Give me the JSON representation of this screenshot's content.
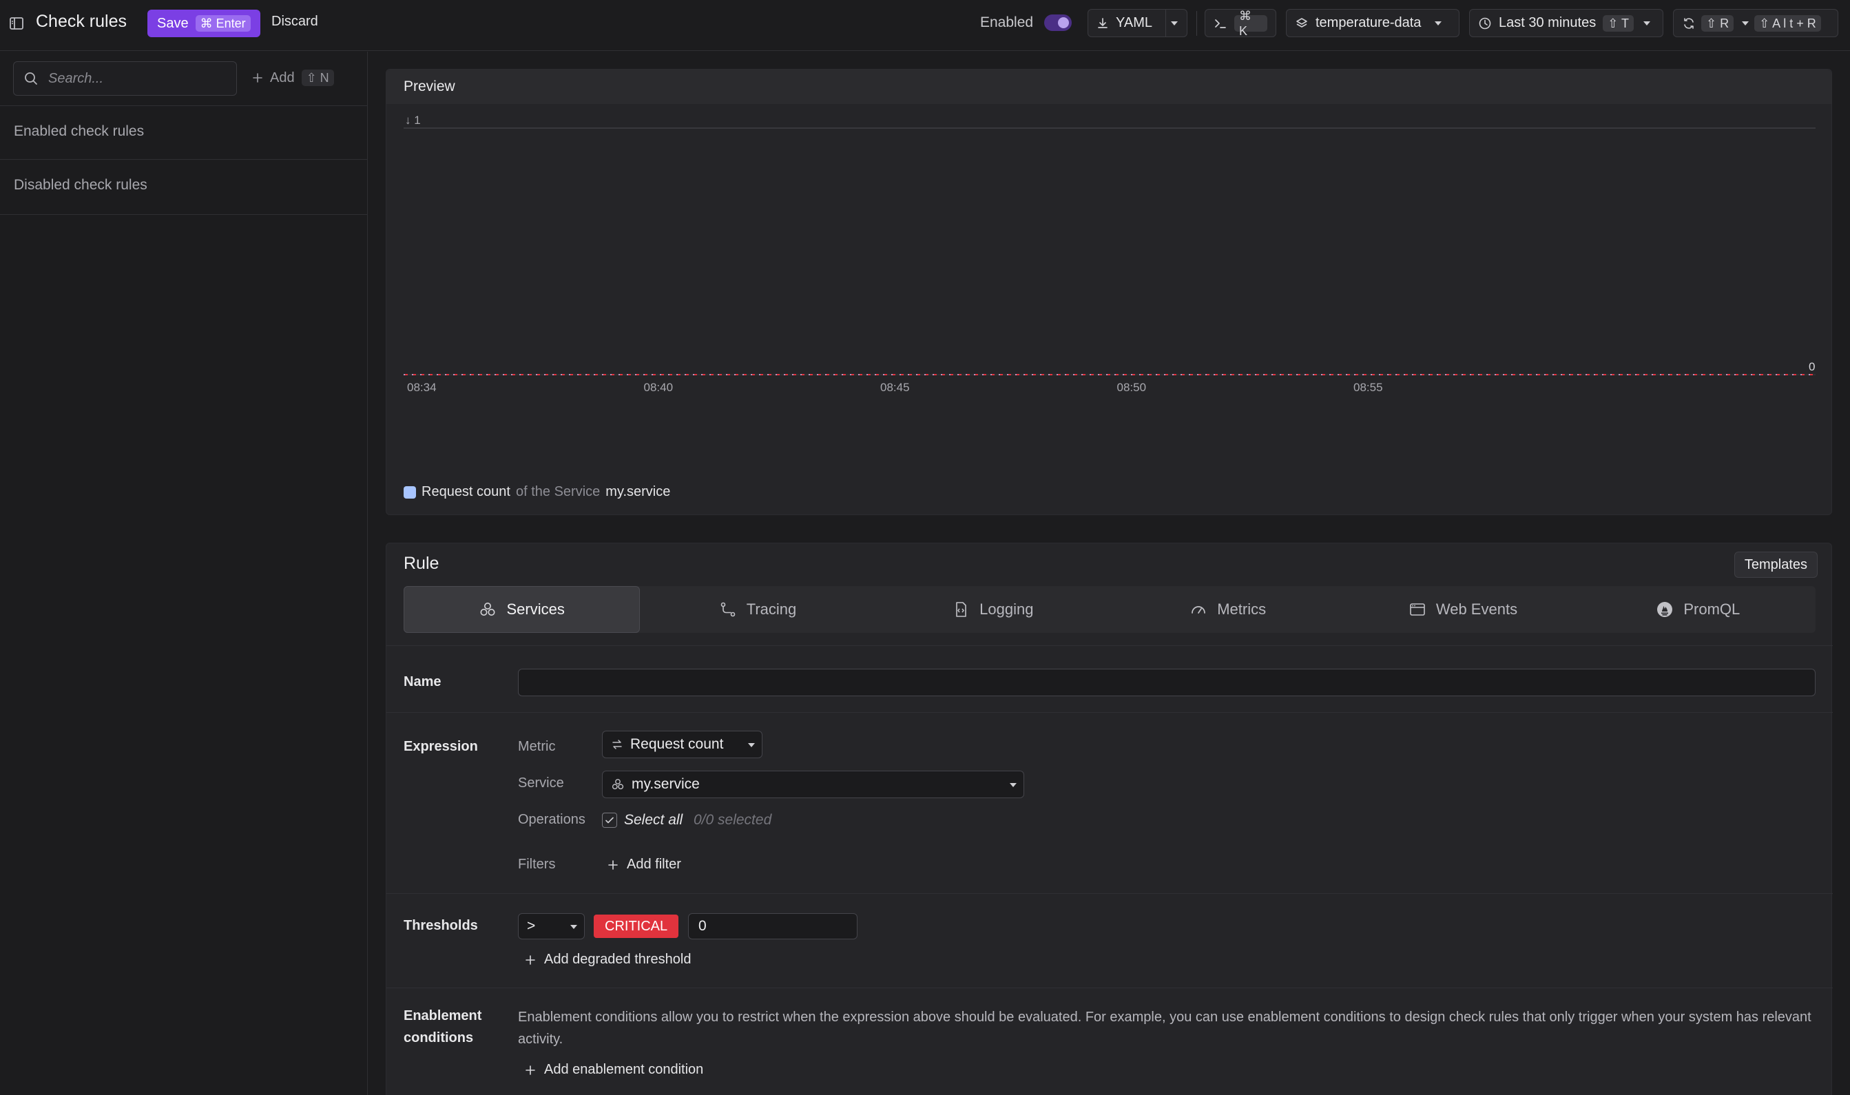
{
  "header": {
    "title": "Check rules",
    "save_label": "Save",
    "save_shortcut": "⌘ Enter",
    "discard_label": "Discard",
    "enabled_label": "Enabled",
    "enabled": true,
    "yaml_label": "YAML",
    "command_shortcut": "⌘ K",
    "dataset": "temperature-data",
    "time_range": "Last 30 minutes",
    "time_shortcut": "⇧ T",
    "refresh_shortcut": "⇧ R",
    "auto_refresh_shortcut": "⇧ A l t + R",
    "accent_color": "#7b3fe4"
  },
  "sidebar": {
    "search_placeholder": "Search...",
    "add_label": "Add",
    "add_shortcut": "⇧ N",
    "groups": [
      "Enabled check rules",
      "Disabled check rules"
    ]
  },
  "preview": {
    "title": "Preview",
    "legend": {
      "metric": "Request count",
      "connector": "of the Service",
      "service": "my.service",
      "color": "#a8c5ff"
    }
  },
  "chart_data": {
    "type": "line",
    "x": [
      "08:34",
      "08:40",
      "08:45",
      "08:50",
      "08:55"
    ],
    "series": [
      {
        "name": "Request count of the Service my.service",
        "values": [
          0,
          0,
          0,
          0,
          0
        ]
      }
    ],
    "threshold": {
      "value": 0,
      "color": "#e1333d"
    },
    "y_top_label": "1",
    "y_right_label": "0",
    "ylim": [
      0,
      1
    ],
    "grid": true
  },
  "rule": {
    "title": "Rule",
    "templates_label": "Templates",
    "tabs": [
      {
        "label": "Services",
        "icon": "services-icon",
        "active": true
      },
      {
        "label": "Tracing",
        "icon": "tracing-icon",
        "active": false
      },
      {
        "label": "Logging",
        "icon": "logging-icon",
        "active": false
      },
      {
        "label": "Metrics",
        "icon": "metrics-gauge-icon",
        "active": false
      },
      {
        "label": "Web Events",
        "icon": "web-events-icon",
        "active": false
      },
      {
        "label": "PromQL",
        "icon": "promql-icon",
        "active": false
      }
    ],
    "name_label": "Name",
    "name_value": "",
    "expression_label": "Expression",
    "metric_label": "Metric",
    "metric_value": "Request count",
    "service_label": "Service",
    "service_value": "my.service",
    "operations_label": "Operations",
    "select_all_label": "Select all",
    "operations_count": "0/0 selected",
    "filters_label": "Filters",
    "add_filter_label": "Add filter",
    "thresholds_label": "Thresholds",
    "threshold_operator": ">",
    "threshold_severity": "CRITICAL",
    "threshold_value": "0",
    "add_degraded_label": "Add degraded threshold",
    "enablement_label_line1": "Enablement",
    "enablement_label_line2": "conditions",
    "enablement_text": "Enablement conditions allow you to restrict when the expression above should be evaluated. For example, you can use enablement conditions to design check rules that only trigger when your system has relevant activity.",
    "add_enablement_label": "Add enablement condition"
  }
}
